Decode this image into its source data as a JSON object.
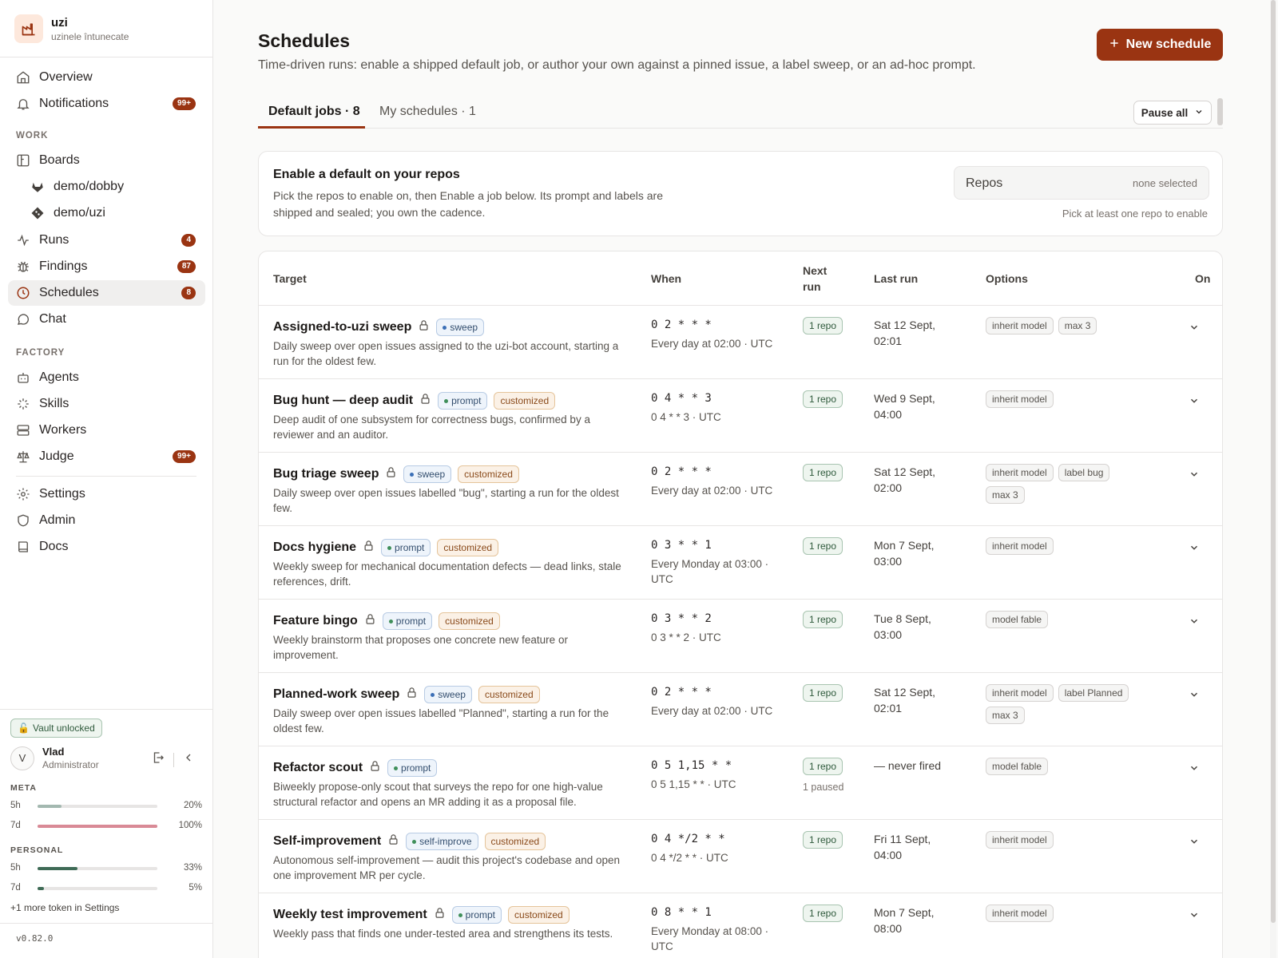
{
  "brand": {
    "name": "uzi",
    "subtitle": "uzinele întunecate"
  },
  "nav": {
    "overview": "Overview",
    "notifications": {
      "label": "Notifications",
      "badge": "99+"
    },
    "work_section": "WORK",
    "boards": "Boards",
    "board_dobby": "demo/dobby",
    "board_uzi": "demo/uzi",
    "runs": {
      "label": "Runs",
      "badge": "4"
    },
    "findings": {
      "label": "Findings",
      "badge": "87"
    },
    "schedules": {
      "label": "Schedules",
      "badge": "8"
    },
    "chat": "Chat",
    "factory_section": "FACTORY",
    "agents": "Agents",
    "skills": "Skills",
    "workers": "Workers",
    "judge": {
      "label": "Judge",
      "badge": "99+"
    },
    "settings": "Settings",
    "admin": "Admin",
    "docs": "Docs"
  },
  "vault": "Vault unlocked",
  "user": {
    "initial": "V",
    "name": "Vlad",
    "role": "Administrator"
  },
  "usage": {
    "meta_label": "META",
    "meta": [
      {
        "label": "5h",
        "value": "20%",
        "fraction": 0.2,
        "color": "#a3b8b0"
      },
      {
        "label": "7d",
        "value": "100%",
        "fraction": 1.0,
        "color": "#d98a96"
      }
    ],
    "personal_label": "PERSONAL",
    "personal": [
      {
        "label": "5h",
        "value": "33%",
        "fraction": 0.33,
        "color": "#3f6b56"
      },
      {
        "label": "7d",
        "value": "5%",
        "fraction": 0.05,
        "color": "#3f6b56"
      }
    ],
    "more": "+1 more token in Settings"
  },
  "version": "v0.82.0",
  "page": {
    "title": "Schedules",
    "subtitle": "Time-driven runs: enable a shipped default job, or author your own against a pinned issue, a label sweep, or an ad-hoc prompt.",
    "new_button": "New schedule",
    "tabs": [
      "Default jobs · 8",
      "My schedules · 1"
    ],
    "pause_all": "Pause all"
  },
  "enable_card": {
    "title": "Enable a default on your repos",
    "text": "Pick the repos to enable on, then Enable a job below. Its prompt and labels are shipped and sealed; you own the cadence.",
    "repos_label": "Repos",
    "repos_value": "none selected",
    "hint": "Pick at least one repo to enable"
  },
  "columns": {
    "target": "Target",
    "when": "When",
    "next_run": "Next run",
    "last_run": "Last run",
    "options": "Options",
    "on": "On"
  },
  "colors": {
    "accent": "#9a3412",
    "sweep_dot": "#3b6fb6",
    "prompt_dot": "#3f8f5a",
    "self_improve_dot": "#3f8f5a"
  },
  "rows": [
    {
      "name": "Assigned-to-uzi sweep",
      "kind": "sweep",
      "customized": "",
      "desc": "Daily sweep over open issues assigned to the uzi-bot account, starting a run for the oldest few.",
      "cron": "0 2 * * *",
      "cron_human": "Every day at 02:00 · UTC",
      "next": "1 repo",
      "paused": "",
      "last": "Sat 12 Sept, 02:01",
      "options": [
        "inherit model",
        "max 3"
      ]
    },
    {
      "name": "Bug hunt — deep audit",
      "kind": "prompt",
      "customized": "customized",
      "desc": "Deep audit of one subsystem for correctness bugs, confirmed by a reviewer and an auditor.",
      "cron": "0 4 * * 3",
      "cron_human": "0 4 * * 3 · UTC",
      "next": "1 repo",
      "paused": "",
      "last": "Wed 9 Sept, 04:00",
      "options": [
        "inherit model"
      ]
    },
    {
      "name": "Bug triage sweep",
      "kind": "sweep",
      "customized": "customized",
      "desc": "Daily sweep over open issues labelled \"bug\", starting a run for the oldest few.",
      "cron": "0 2 * * *",
      "cron_human": "Every day at 02:00 · UTC",
      "next": "1 repo",
      "paused": "",
      "last": "Sat 12 Sept, 02:00",
      "options": [
        "inherit model",
        "label bug",
        "max 3"
      ]
    },
    {
      "name": "Docs hygiene",
      "kind": "prompt",
      "customized": "customized",
      "desc": "Weekly sweep for mechanical documentation defects — dead links, stale references, drift.",
      "cron": "0 3 * * 1",
      "cron_human": "Every Monday at 03:00 · UTC",
      "next": "1 repo",
      "paused": "",
      "last": "Mon 7 Sept, 03:00",
      "options": [
        "inherit model"
      ]
    },
    {
      "name": "Feature bingo",
      "kind": "prompt",
      "customized": "customized",
      "desc": "Weekly brainstorm that proposes one concrete new feature or improvement.",
      "cron": "0 3 * * 2",
      "cron_human": "0 3 * * 2 · UTC",
      "next": "1 repo",
      "paused": "",
      "last": "Tue 8 Sept, 03:00",
      "options": [
        "model fable"
      ]
    },
    {
      "name": "Planned-work sweep",
      "kind": "sweep",
      "customized": "customized",
      "desc": "Daily sweep over open issues labelled \"Planned\", starting a run for the oldest few.",
      "cron": "0 2 * * *",
      "cron_human": "Every day at 02:00 · UTC",
      "next": "1 repo",
      "paused": "",
      "last": "Sat 12 Sept, 02:01",
      "options": [
        "inherit model",
        "label Planned",
        "max 3"
      ]
    },
    {
      "name": "Refactor scout",
      "kind": "prompt",
      "customized": "",
      "desc": "Biweekly propose-only scout that surveys the repo for one high-value structural refactor and opens an MR adding it as a proposal file.",
      "cron": "0 5 1,15 * *",
      "cron_human": "0 5 1,15 * * · UTC",
      "next": "1 repo",
      "paused": "1 paused",
      "last": "— never fired",
      "options": [
        "model fable"
      ]
    },
    {
      "name": "Self-improvement",
      "kind": "self-improve",
      "customized": "customized",
      "desc": "Autonomous self-improvement — audit this project's codebase and open one improvement MR per cycle.",
      "cron": "0 4 */2 * *",
      "cron_human": "0 4 */2 * * · UTC",
      "next": "1 repo",
      "paused": "",
      "last": "Fri 11 Sept, 04:00",
      "options": [
        "inherit model"
      ]
    },
    {
      "name": "Weekly test improvement",
      "kind": "prompt",
      "customized": "customized",
      "desc": "Weekly pass that finds one under-tested area and strengthens its tests.",
      "cron": "0 8 * * 1",
      "cron_human": "Every Monday at 08:00 · UTC",
      "next": "1 repo",
      "paused": "",
      "last": "Mon 7 Sept, 08:00",
      "options": [
        "inherit model"
      ]
    }
  ]
}
